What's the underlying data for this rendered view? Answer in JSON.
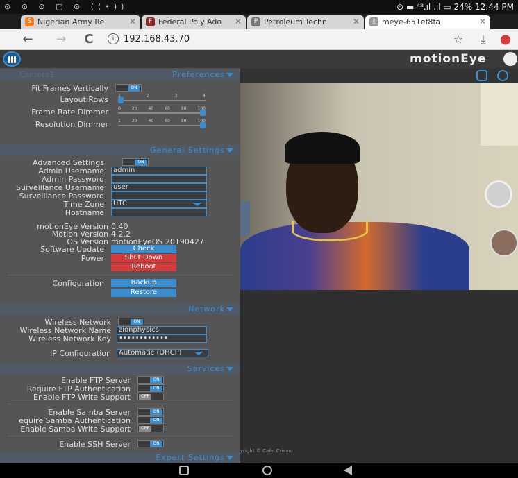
{
  "status_bar": {
    "left_icons": "⊙ ⊙ ⊙ ▢ ⊙ ((•))",
    "right": "⊚ ▬ ⁴⁸.ıl .ıl ▭ 24% 12:44 PM"
  },
  "tabs": [
    {
      "label": "Nigerian Army Re",
      "icon_letter": "S",
      "icon_color": "#ff7b1a"
    },
    {
      "label": "Federal Poly Ado",
      "icon_letter": "F",
      "icon_color": "#8a2b2b"
    },
    {
      "label": "Petroleum Techn",
      "icon_letter": "P",
      "icon_color": "#777"
    },
    {
      "label": "meye-651ef8fa",
      "icon_letter": "▯",
      "icon_color": "#999"
    }
  ],
  "address_bar": {
    "url": "192.168.43.70",
    "back_icon": "←",
    "forward_icon": "→",
    "reload_icon": "C"
  },
  "header": {
    "title": "motionEye"
  },
  "panel": {
    "camera_name": "Camera1",
    "preferences": {
      "title": "Preferences",
      "fit_frames_label": "Fit Frames Vertically",
      "fit_frames_value": "ON",
      "layout_rows_label": "Layout Rows",
      "layout_rows_ticks": [
        "1",
        "2",
        "3",
        "4"
      ],
      "frame_rate_label": "Frame Rate Dimmer",
      "frame_rate_ticks": [
        "0",
        "20",
        "40",
        "60",
        "80",
        "100"
      ],
      "resolution_label": "Resolution Dimmer",
      "resolution_ticks": [
        "1",
        "20",
        "40",
        "60",
        "80",
        "100"
      ]
    },
    "general": {
      "title": "General Settings",
      "advanced_label": "Advanced Settings",
      "advanced_value": "ON",
      "admin_user_label": "Admin Username",
      "admin_user_value": "admin",
      "admin_pass_label": "Admin Password",
      "surv_user_label": "Surveillance Username",
      "surv_user_value": "user",
      "surv_pass_label": "Surveillance Password",
      "timezone_label": "Time Zone",
      "timezone_value": "UTC",
      "hostname_label": "Hostname",
      "meye_version_label": "motionEye Version",
      "meye_version_value": "0.40",
      "motion_version_label": "Motion Version",
      "motion_version_value": "4.2.2",
      "os_version_label": "OS Version",
      "os_version_value": "motionEyeOS 20190427",
      "update_label": "Software Update",
      "update_button": "Check",
      "power_label": "Power",
      "shutdown_button": "Shut Down",
      "reboot_button": "Reboot",
      "config_label": "Configuration",
      "backup_button": "Backup",
      "restore_button": "Restore"
    },
    "network": {
      "title": "Network",
      "wifi_label": "Wireless Network",
      "wifi_value": "ON",
      "wifi_name_label": "Wireless Network Name",
      "wifi_name_value": "zionphysics",
      "wifi_key_label": "Wireless Network Key",
      "wifi_key_value": "••••••••••••",
      "ip_label": "IP Configuration",
      "ip_value": "Automatic (DHCP)"
    },
    "services": {
      "title": "Services",
      "ftp_label": "Enable FTP Server",
      "ftp_value": "ON",
      "ftp_auth_label": "Require FTP Authentication",
      "ftp_auth_value": "ON",
      "ftp_write_label": "Enable FTP Write Support",
      "ftp_write_value": "OFF",
      "samba_label": "Enable Samba Server",
      "samba_value": "ON",
      "samba_auth_label": "equire Samba Authentication",
      "samba_auth_value": "ON",
      "samba_write_label": "Enable Samba Write Support",
      "samba_write_value": "OFF",
      "ssh_label": "Enable SSH Server",
      "ssh_value": "ON"
    },
    "expert": {
      "title": "Expert Settings"
    }
  },
  "camera_area": {
    "copyright": "yright © Calin Crisan"
  },
  "colors": {
    "accent": "#3c8dcd",
    "danger": "#d43c3c",
    "panel_bg": "#555555"
  }
}
